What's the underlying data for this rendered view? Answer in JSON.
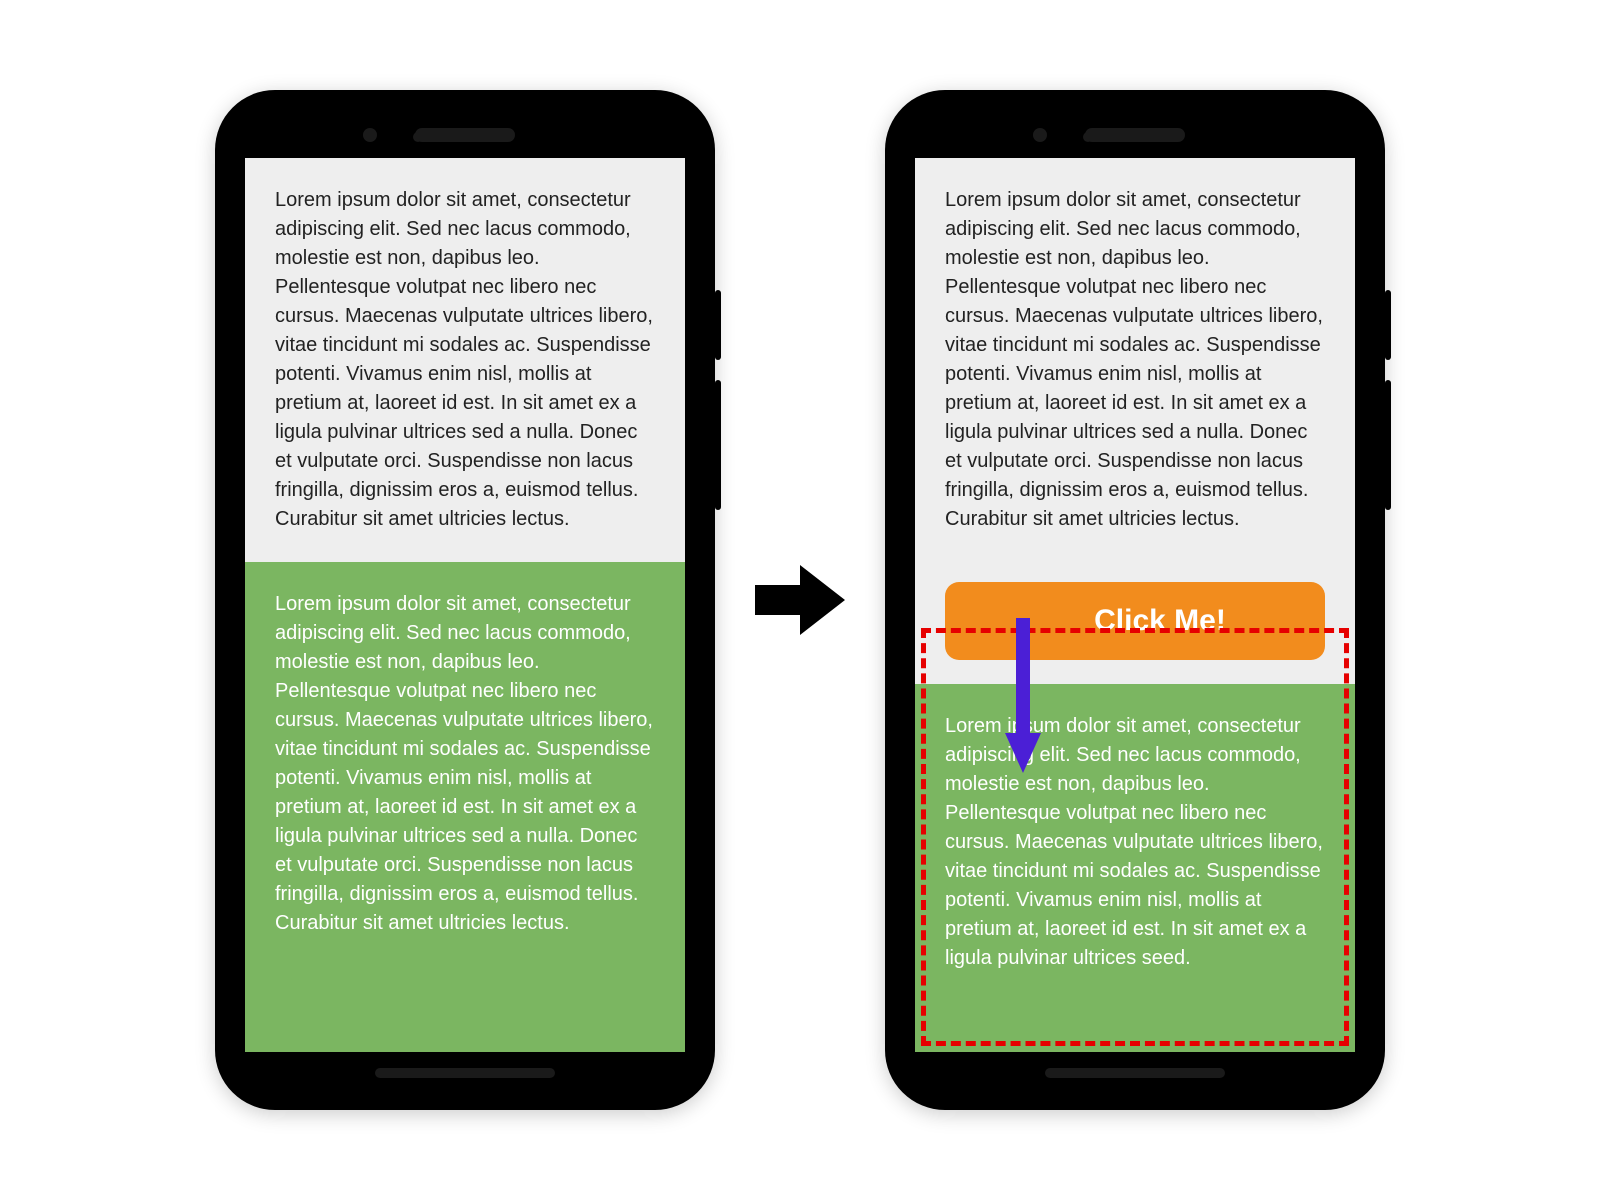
{
  "left_phone": {
    "paragraph_top": "Lorem ipsum dolor sit amet, consectetur adipiscing elit. Sed nec lacus commodo, molestie est non, dapibus leo. Pellentesque volutpat nec libero nec cursus. Maecenas vulputate ultrices libero, vitae tincidunt mi sodales ac. Suspendisse potenti. Vivamus enim nisl, mollis at pretium at, laoreet id est. In sit amet ex a ligula pulvinar ultrices sed a nulla. Donec et vulputate orci. Suspendisse non lacus fringilla, dignissim eros a, euismod tellus. Curabitur sit amet ultricies lectus.",
    "paragraph_bottom": "Lorem ipsum dolor sit amet, consectetur adipiscing elit. Sed nec lacus commodo, molestie est non, dapibus leo. Pellentesque volutpat nec libero nec cursus. Maecenas vulputate ultrices libero, vitae tincidunt mi sodales ac. Suspendisse potenti. Vivamus enim nisl, mollis at pretium at, laoreet id est. In sit amet ex a ligula pulvinar ultrices sed a nulla. Donec et vulputate orci. Suspendisse non lacus fringilla, dignissim eros a, euismod tellus. Curabitur sit amet ultricies lectus."
  },
  "right_phone": {
    "paragraph_top": "Lorem ipsum dolor sit amet, consectetur adipiscing elit. Sed nec lacus commodo, molestie est non, dapibus leo. Pellentesque volutpat nec libero nec cursus. Maecenas vulputate ultrices libero, vitae tincidunt mi sodales ac. Suspendisse potenti. Vivamus enim nisl, mollis at pretium at, laoreet id est. In sit amet ex a ligula pulvinar ultrices sed a nulla. Donec et vulputate orci. Suspendisse non lacus fringilla, dignissim eros a, euismod tellus. Curabitur sit amet ultricies lectus.",
    "button_label": "Click Me!",
    "paragraph_bottom": "Lorem ipsum dolor sit amet, consectetur adipiscing elit. Sed nec lacus commodo, molestie est non, dapibus leo. Pellentesque volutpat nec libero nec cursus. Maecenas vulputate ultrices libero, vitae tincidunt mi sodales ac. Suspendisse potenti. Vivamus enim nisl, mollis at pretium at, laoreet id est. In sit amet ex a ligula pulvinar ultrices seed."
  },
  "colors": {
    "green": "#7bb661",
    "orange": "#f28c1d",
    "page_bg": "#eeeeee",
    "highlight_dash": "#e60000",
    "shift_arrow": "#4b1fd6"
  }
}
